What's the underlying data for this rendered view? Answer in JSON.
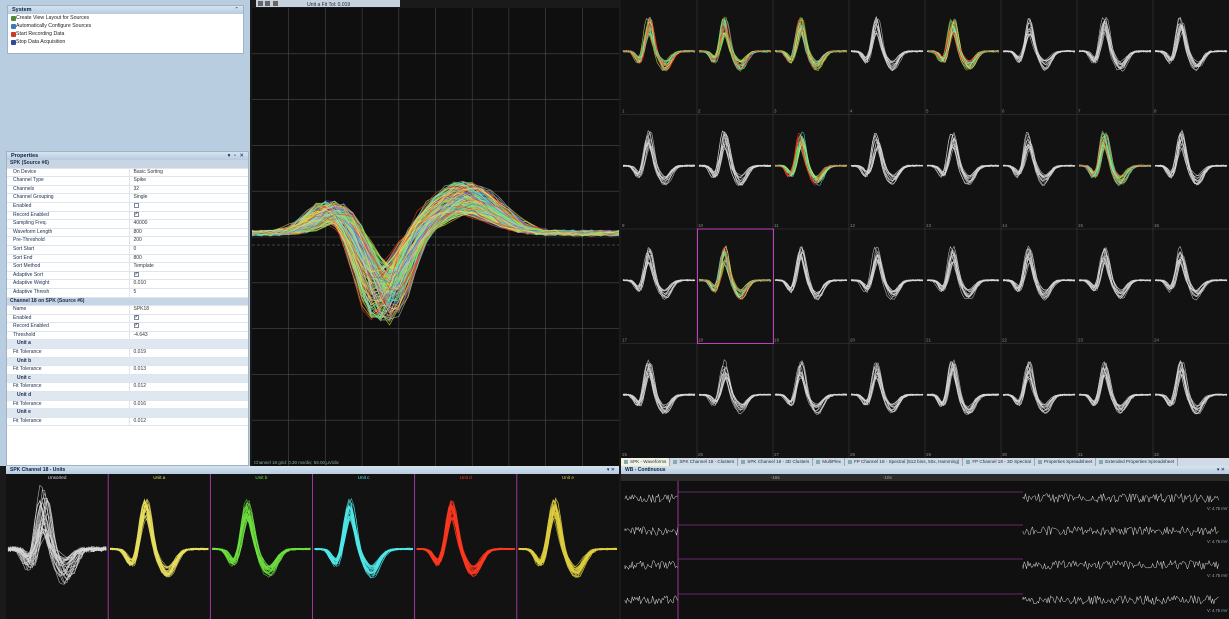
{
  "system": {
    "title": "System",
    "items": [
      {
        "label": "Create View Layout for Sources",
        "icon": "layout-icon",
        "color": "#4b8a3a"
      },
      {
        "label": "Automatically Configure Sources",
        "icon": "wand-icon",
        "color": "#3a7ab8"
      },
      {
        "label": "Start Recording Data",
        "icon": "record-icon",
        "color": "#c83a2a"
      },
      {
        "label": "Stop Data Acquisition",
        "icon": "stop-icon",
        "color": "#2a4a9a"
      }
    ]
  },
  "properties": {
    "title": "Properties",
    "controls": "▾ ▫ ✕",
    "rows": [
      {
        "type": "cat",
        "label": "SPK (Source #6)"
      },
      {
        "label": "On Device",
        "value": "Basic Sorting"
      },
      {
        "label": "Channel Type",
        "value": "Spike"
      },
      {
        "label": "Channels",
        "value": "32"
      },
      {
        "label": "Channel Grouping",
        "value": "Single"
      },
      {
        "label": "Enabled",
        "check": false
      },
      {
        "label": "Record Enabled",
        "check": true
      },
      {
        "label": "Sampling Freq.",
        "value": "40000"
      },
      {
        "label": "Waveform Length",
        "value": "800"
      },
      {
        "label": "Pre-Threshold",
        "value": "200"
      },
      {
        "label": "Sort Start",
        "value": "0"
      },
      {
        "label": "Sort End",
        "value": "800"
      },
      {
        "label": "Sort Method",
        "value": "Template"
      },
      {
        "label": "Adaptive Sort",
        "check": true
      },
      {
        "label": "Adaptive Weight",
        "value": "0.010"
      },
      {
        "label": "Adaptive Thresh",
        "value": "5"
      },
      {
        "type": "cat",
        "label": "Channel 18 on SPK (Source #6)"
      },
      {
        "label": "Name",
        "value": "SPK18"
      },
      {
        "label": "Enabled",
        "check": true
      },
      {
        "label": "Record Enabled",
        "check": true
      },
      {
        "label": "Threshold",
        "value": "-4.643"
      },
      {
        "type": "sub",
        "label": "Unit a"
      },
      {
        "label": "Fit Tolerance",
        "value": "0.019"
      },
      {
        "type": "sub",
        "label": "Unit b"
      },
      {
        "label": "Fit Tolerance",
        "value": "0.013"
      },
      {
        "type": "sub",
        "label": "Unit c"
      },
      {
        "label": "Fit Tolerance",
        "value": "0.012"
      },
      {
        "type": "sub",
        "label": "Unit d"
      },
      {
        "label": "Fit Tolerance",
        "value": "0.016"
      },
      {
        "type": "sub",
        "label": "Unit e"
      },
      {
        "label": "Fit Tolerance",
        "value": "0.012"
      }
    ]
  },
  "center": {
    "title": "Unit a Fit Tol: 0.019",
    "footer": "Channel 18       grid: 0.30 ms/div; 59.00 µV/div"
  },
  "grid": {
    "cell_labels": [
      "1",
      "2",
      "3",
      "4",
      "5",
      "6",
      "7",
      "8",
      "9",
      "10",
      "11",
      "12",
      "13",
      "14",
      "15",
      "16",
      "17",
      "18",
      "19",
      "20",
      "21",
      "22",
      "23",
      "24",
      "25",
      "26",
      "27",
      "28",
      "29",
      "30",
      "31",
      "32"
    ],
    "colored_channels": [
      "1",
      "2",
      "3",
      "5",
      "11",
      "15",
      "18"
    ]
  },
  "tabs": [
    {
      "label": "SPK - Waveforms",
      "active": true
    },
    {
      "label": "SPK Channel 18 - Clusters",
      "active": false
    },
    {
      "label": "SPK Channel 18 - 3D Clusters",
      "active": false
    },
    {
      "label": "MultiPlex",
      "active": false
    },
    {
      "label": "FP Channel 18 - Spectral (512 bins, 50x, Hamming)",
      "active": false
    },
    {
      "label": "FP Channel 18 - 3D Spectral",
      "active": false
    },
    {
      "label": "Properties Spreadsheet",
      "active": false
    },
    {
      "label": "Extended Properties Spreadsheet",
      "active": false
    }
  ],
  "units": {
    "title": "SPK Channel 18 - Units",
    "controls": "▾ ✕",
    "columns": [
      {
        "label": "Unsorted",
        "color": "#d8d8d8"
      },
      {
        "label": "Unit a",
        "color": "#e8e060"
      },
      {
        "label": "Unit b",
        "color": "#6ee040"
      },
      {
        "label": "Unit c",
        "color": "#50e8e8"
      },
      {
        "label": "Unit d",
        "color": "#ff3a20"
      },
      {
        "label": "Unit e",
        "color": "#e0d040"
      }
    ]
  },
  "continuous": {
    "title": "WB - Continuous",
    "controls": "▾ ✕",
    "scale_label": "V: 4.75 mV",
    "time_labels": [
      "-16s",
      "-10s"
    ]
  },
  "colors": {
    "accent_magenta": "#c040c0",
    "panel_bg": "#b9cde0"
  }
}
